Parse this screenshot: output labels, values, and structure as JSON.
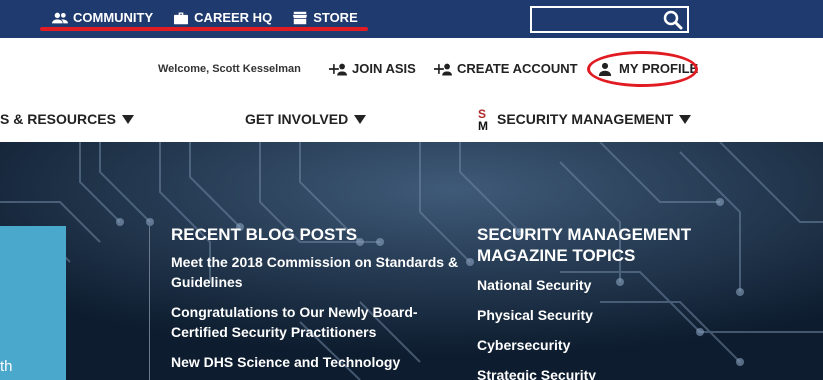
{
  "topnav": {
    "items": [
      {
        "label": "COMMUNITY",
        "icon": "people-icon"
      },
      {
        "label": "CAREER HQ",
        "icon": "briefcase-icon"
      },
      {
        "label": "STORE",
        "icon": "store-icon"
      }
    ]
  },
  "search": {
    "value": "",
    "placeholder": ""
  },
  "util": {
    "welcome": "Welcome, Scott Kesselman",
    "join": "JOIN ASIS",
    "create": "CREATE ACCOUNT",
    "profile": "MY PROFILE"
  },
  "mainnav": {
    "resources": "S & RESOURCES",
    "involved": "GET INVOLVED",
    "secmgmt": "SECURITY MANAGEMENT",
    "sm_logo": {
      "s": "S",
      "m": "M"
    }
  },
  "hero": {
    "panel_text": "th",
    "blog": {
      "heading": "RECENT BLOG POSTS",
      "posts": [
        "Meet the 2018 Commission on Standards & Guidelines",
        "Congratulations to Our Newly Board-Certified Security Practitioners",
        "New DHS Science and Technology"
      ]
    },
    "topics": {
      "heading": "SECURITY MANAGEMENT MAGAZINE TOPICS",
      "items": [
        "National Security",
        "Physical Security",
        "Cybersecurity",
        "Strategic Security"
      ]
    }
  },
  "colors": {
    "topbar": "#1e3a6e",
    "accent_red": "#e11b22",
    "hero_bg": "#0d1c2e",
    "panel_blue": "#4aa8cc"
  }
}
